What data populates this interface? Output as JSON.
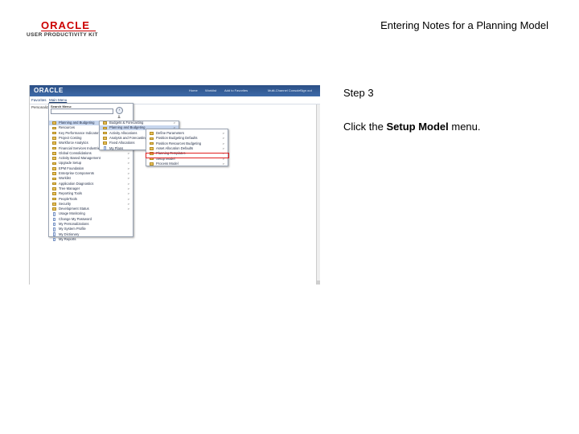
{
  "header": {
    "logo_oracle": "ORACLE",
    "logo_upk": "USER PRODUCTIVITY KIT",
    "doc_title": "Entering Notes for a Planning Model"
  },
  "instructions": {
    "step": "Step 3",
    "text_before": "Click the ",
    "target": "Setup Model",
    "text_after": " menu."
  },
  "screenshot": {
    "brand": "ORACLE",
    "nav_links": [
      "Home",
      "Worklist",
      "Add to Favorites",
      "Multi-Channel Console",
      "Sign out"
    ],
    "favorites": "Favorites",
    "main_menu": "Main Menu",
    "page_label": "Personalize",
    "search_caption": "Search Menu:",
    "main_menu_items": [
      {
        "label": "Planning and Budgeting",
        "icon": "folder-icon",
        "arrow": ""
      },
      {
        "label": "Resources",
        "icon": "folder-icon",
        "arrow": ">"
      },
      {
        "label": "Key Performance Indicators",
        "icon": "folder-icon",
        "arrow": ">"
      },
      {
        "label": "Project Costing",
        "icon": "folder-icon",
        "arrow": ">"
      },
      {
        "label": "Workforce Analytics",
        "icon": "folder-icon",
        "arrow": ">"
      },
      {
        "label": "Financial Services Industries",
        "icon": "folder-icon",
        "arrow": ">"
      },
      {
        "label": "Global Consolidations",
        "icon": "folder-icon",
        "arrow": ">"
      },
      {
        "label": "Activity Based Management",
        "icon": "folder-icon",
        "arrow": ">"
      },
      {
        "label": "Upgrade Setup",
        "icon": "folder-icon",
        "arrow": ">"
      },
      {
        "label": "EPM Foundation",
        "icon": "folder-icon",
        "arrow": ">"
      },
      {
        "label": "Enterprise Components",
        "icon": "folder-icon",
        "arrow": ">"
      },
      {
        "label": "Worklist",
        "icon": "folder-icon",
        "arrow": ">"
      },
      {
        "label": "Application Diagnostics",
        "icon": "folder-icon",
        "arrow": ">"
      },
      {
        "label": "Tree Manager",
        "icon": "folder-icon",
        "arrow": ">"
      },
      {
        "label": "Reporting Tools",
        "icon": "folder-icon",
        "arrow": ">"
      },
      {
        "label": "PeopleTools",
        "icon": "folder-icon",
        "arrow": ">"
      },
      {
        "label": "Security",
        "icon": "folder-icon",
        "arrow": ">"
      },
      {
        "label": "Development Status",
        "icon": "folder-icon",
        "arrow": ">"
      },
      {
        "label": "Usage Monitoring",
        "icon": "document-icon",
        "arrow": ""
      },
      {
        "label": "Change My Password",
        "icon": "document-icon",
        "arrow": ""
      },
      {
        "label": "My Personalizations",
        "icon": "document-icon",
        "arrow": ""
      },
      {
        "label": "My System Profile",
        "icon": "document-icon",
        "arrow": ""
      },
      {
        "label": "My Dictionary",
        "icon": "document-icon",
        "arrow": ""
      },
      {
        "label": "My Reports",
        "icon": "document-icon",
        "arrow": ""
      }
    ],
    "submenu_planning": [
      {
        "label": "Budgets & Forecasting",
        "icon": "folder-icon",
        "arrow": ">"
      },
      {
        "label": "Planning and Budgeting",
        "icon": "folder-icon",
        "arrow": ">"
      },
      {
        "label": "Activity Allocations",
        "icon": "folder-icon",
        "arrow": ">"
      },
      {
        "label": "Analysis and Forecasting",
        "icon": "folder-icon",
        "arrow": ">"
      },
      {
        "label": "Fixed Allocations",
        "icon": "folder-icon",
        "arrow": ">"
      },
      {
        "label": "My Plans",
        "icon": "document-icon",
        "arrow": ""
      }
    ],
    "submenu_setup": [
      {
        "label": "Define Parameters",
        "icon": "folder-icon",
        "arrow": ">"
      },
      {
        "label": "Position Budgeting Defaults",
        "icon": "folder-icon",
        "arrow": ">"
      },
      {
        "label": "Position Resources Budgeting",
        "icon": "folder-icon",
        "arrow": ">"
      },
      {
        "label": "Asset Allocation Defaults",
        "icon": "folder-icon",
        "arrow": ">"
      },
      {
        "label": "Planning Templates",
        "icon": "folder-icon",
        "arrow": ">"
      },
      {
        "label": "Setup Model",
        "icon": "folder-icon",
        "arrow": ">"
      },
      {
        "label": "Process Model",
        "icon": "folder-icon",
        "arrow": ">"
      }
    ]
  }
}
